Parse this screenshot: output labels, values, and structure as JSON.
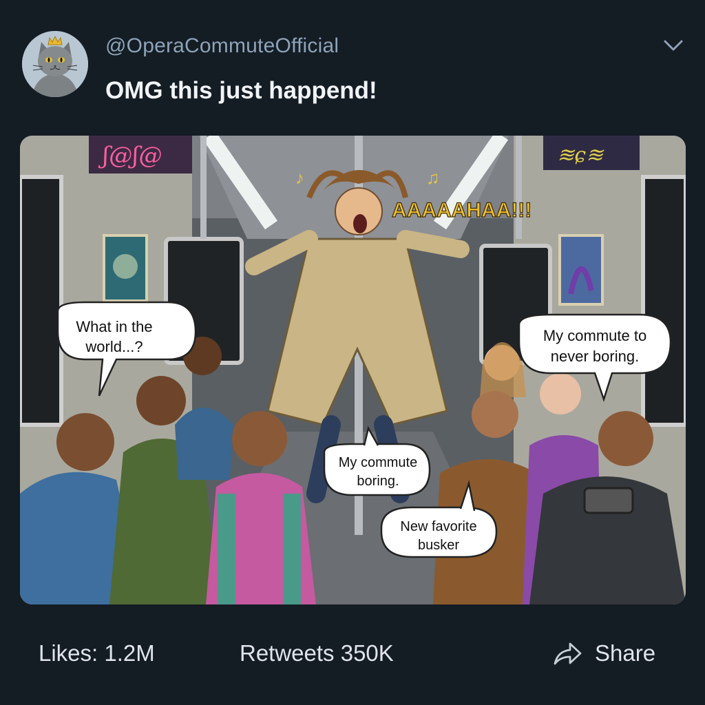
{
  "post": {
    "handle": "@OperaCommuteOfficial",
    "text": "OMG this just happend!"
  },
  "image": {
    "scream": "AAAAAHAA!!!",
    "bubbles": {
      "top_left": [
        "What in the",
        "world...?"
      ],
      "top_right": [
        "My commute to",
        "never boring."
      ],
      "middle": [
        "My commute",
        "boring."
      ],
      "bottom": [
        "New favorite",
        "busker"
      ]
    }
  },
  "actions": {
    "likes": "Likes: 1.2M",
    "retweets": "Retweets 350K",
    "share": "Share"
  },
  "icons": {
    "menu": "chevron-down-icon",
    "share": "share-arrow-icon",
    "avatar": "crowned-cat-avatar"
  },
  "colors": {
    "background": "#141c24",
    "handle": "#8ea3b8",
    "text": "#f1f4f7"
  }
}
